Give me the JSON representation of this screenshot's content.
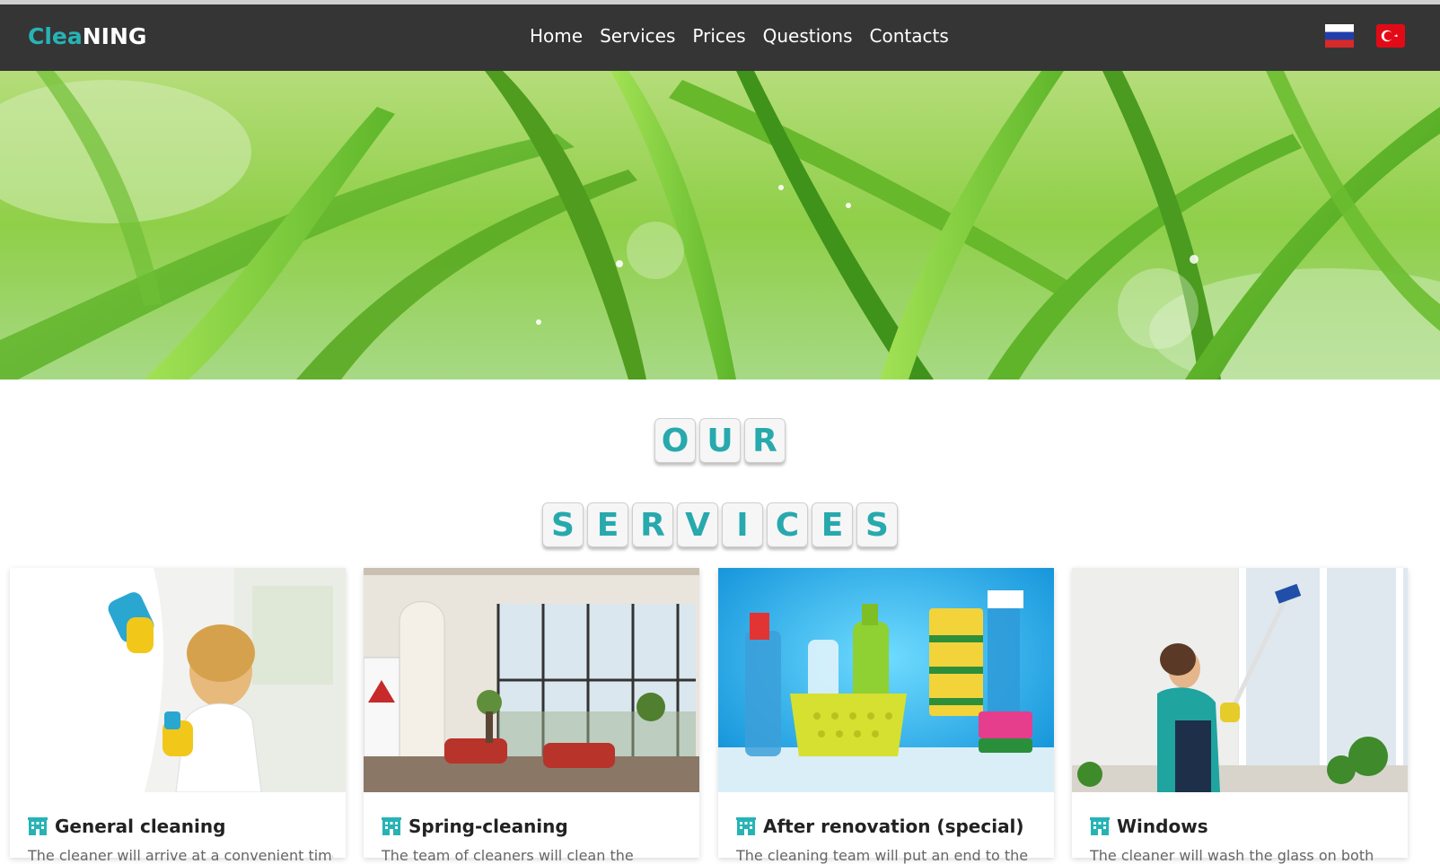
{
  "brand": {
    "part1": "Clea",
    "part2": "NING"
  },
  "nav": {
    "items": [
      {
        "label": "Home"
      },
      {
        "label": "Services"
      },
      {
        "label": "Prices"
      },
      {
        "label": "Questions"
      },
      {
        "label": "Contacts"
      }
    ]
  },
  "languages": [
    {
      "name": "russian-flag-icon"
    },
    {
      "name": "turkey-flag-icon"
    }
  ],
  "heading": {
    "word1": [
      "O",
      "U",
      "R"
    ],
    "word2": [
      "S",
      "E",
      "R",
      "V",
      "I",
      "C",
      "E",
      "S"
    ]
  },
  "colors": {
    "accent": "#27b3b6",
    "navbar": "#353535"
  },
  "services": [
    {
      "title": "General cleaning",
      "desc": "The cleaner will arrive at a convenient time",
      "icon": "building-icon"
    },
    {
      "title": "Spring-cleaning",
      "desc": "The team of cleaners will clean the",
      "icon": "building-icon"
    },
    {
      "title": "After renovation (special)",
      "desc": "The cleaning team will put an end to the",
      "icon": "building-icon"
    },
    {
      "title": "Windows",
      "desc": "The cleaner will wash the glass on both",
      "icon": "building-icon"
    }
  ]
}
